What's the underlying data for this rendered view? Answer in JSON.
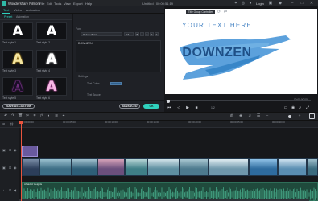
{
  "app": {
    "name": "Wondershare Filmora",
    "menu": [
      "File",
      "Edit",
      "Tools",
      "View",
      "Export",
      "Help"
    ],
    "doc_title": "Untitled : 00:00:51:19",
    "login": "Login"
  },
  "tabs": [
    "Text",
    "Video",
    "Animation"
  ],
  "subtabs": [
    "Preset",
    "Animation"
  ],
  "presets": [
    {
      "letter": "A",
      "label": "Text style 1",
      "color": "#ffffff",
      "glow": "none"
    },
    {
      "letter": "A",
      "label": "Text style 2",
      "color": "#ffffff",
      "glow": "none"
    },
    {
      "letter": "A",
      "label": "Text style 3",
      "color": "#f4e6a2",
      "glow": "#e6b52e"
    },
    {
      "letter": "A",
      "label": "Text style 4",
      "color": "#ffffff",
      "glow": "#ffffff"
    },
    {
      "letter": "A",
      "label": "Text style 5",
      "color": "#1a0e26",
      "glow": "#c04ad8"
    },
    {
      "letter": "A",
      "label": "Text style 6",
      "color": "#f6b9e5",
      "glow": "#e05cc0"
    }
  ],
  "settings": {
    "font_label": "Font",
    "font_value": "Roboto Bold",
    "size_value": "15",
    "text_value": "DOWNZEN",
    "settings_label": "Settings",
    "text_color_label": "Text Color:",
    "text_space_label": "Text Space:",
    "text_color": "#2e5f8d"
  },
  "buttons": {
    "save_custom": "SAVE AS CUSTOM",
    "advanced": "ADVANCED",
    "ok": "OK"
  },
  "preview": {
    "tooltip": "Title Group Controller",
    "line1": "YOUR TEXT HERE",
    "line2": "DOWNZEN",
    "time_right": "00:00:00:05",
    "playback_time": "1/2",
    "progress": 0.0
  },
  "ruler": [
    "00:00:00:00",
    "00:00:05:00",
    "00:00:10:00",
    "00:00:15:00",
    "00:00:20:00",
    "00:00:25:00",
    "00:00:30:00"
  ],
  "title_clip": "T",
  "audio_clip": "Afraid of Heights",
  "colors": {
    "accent": "#2fd1bd",
    "playhead": "#e8543e",
    "brush_blue": "#3f8fd2",
    "title_clip": "#6a5a9e",
    "audio_clip": "#1f4a3c"
  }
}
